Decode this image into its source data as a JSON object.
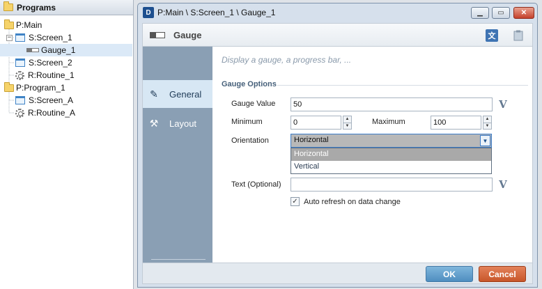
{
  "tree": {
    "header": "Programs",
    "items": [
      {
        "label": "P:Main"
      },
      {
        "label": "S:Screen_1"
      },
      {
        "label": "Gauge_1"
      },
      {
        "label": "S:Screen_2"
      },
      {
        "label": "R:Routine_1"
      },
      {
        "label": "P:Program_1"
      },
      {
        "label": "S:Screen_A"
      },
      {
        "label": "R:Routine_A"
      }
    ]
  },
  "dialog": {
    "app_icon_text": "D",
    "title": "P:Main \\ S:Screen_1 \\ Gauge_1",
    "toolbar_title": "Gauge",
    "nav": [
      {
        "label": "General"
      },
      {
        "label": "Layout"
      }
    ],
    "hint": "Display a gauge, a progress bar, ...",
    "section": "Gauge Options",
    "gauge_value_label": "Gauge Value",
    "gauge_value": "50",
    "minimum_label": "Minimum",
    "minimum_value": "0",
    "maximum_label": "Maximum",
    "maximum_value": "100",
    "orientation_label": "Orientation",
    "orientation_value": "Horizontal",
    "orientation_options": [
      "Horizontal",
      "Vertical"
    ],
    "text_label": "Text (Optional)",
    "text_value": "",
    "variable_glyph": "V",
    "auto_refresh_label": "Auto refresh on data change",
    "auto_refresh_checked": true,
    "ok_label": "OK",
    "cancel_label": "Cancel"
  },
  "colors": {
    "nav_background": "#8a9fb4",
    "nav_active": "#d7e7f4",
    "ok_button": "#5b9bcb",
    "cancel_button": "#d3653a",
    "close_button": "#c4412b"
  }
}
